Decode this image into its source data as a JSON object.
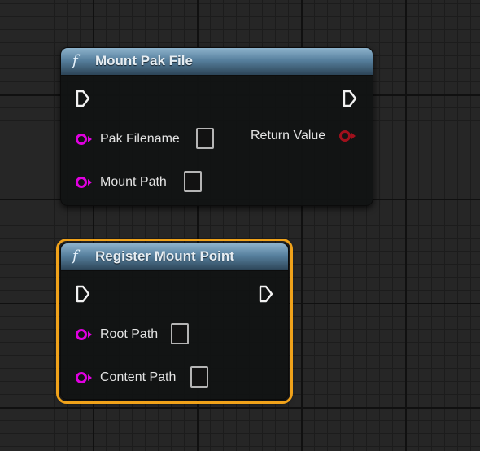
{
  "nodes": {
    "mount_pak_file": {
      "title": "Mount Pak File",
      "icon": "function-icon",
      "icon_glyph": "f",
      "header_color": "#57809e",
      "inputs": [
        {
          "label": "Pak Filename",
          "pin_color": "#e000e0"
        },
        {
          "label": "Mount Path",
          "pin_color": "#e000e0"
        }
      ],
      "outputs": [
        {
          "label": "Return Value",
          "pin_color": "#a0101c"
        }
      ]
    },
    "register_mount_point": {
      "title": "Register Mount Point",
      "icon": "function-icon",
      "icon_glyph": "f",
      "header_color": "#57809e",
      "selected": true,
      "selection_color": "#f0a21a",
      "inputs": [
        {
          "label": "Root Path",
          "pin_color": "#e000e0"
        },
        {
          "label": "Content Path",
          "pin_color": "#e000e0"
        }
      ]
    }
  }
}
